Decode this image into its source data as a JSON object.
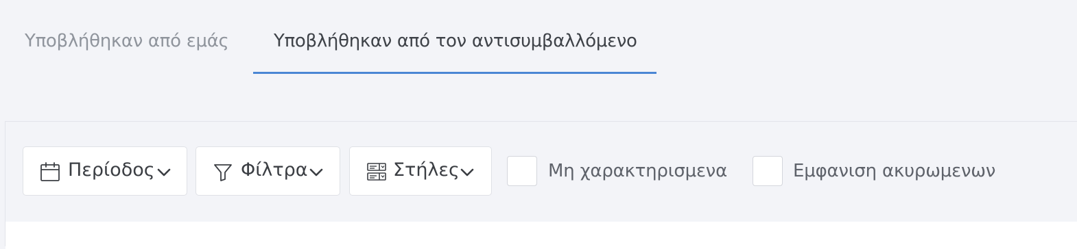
{
  "tabs": [
    {
      "label": "Υποβλήθηκαν από εμάς",
      "active": false
    },
    {
      "label": "Υποβλήθηκαν από τον αντισυμβαλλόμενο",
      "active": true
    }
  ],
  "toolbar": {
    "period_label": "Περίοδος",
    "filters_label": "Φίλτρα",
    "columns_label": "Στήλες",
    "uncharacterized_label": "Μη χαρακτηρισμενα",
    "uncharacterized_checked": false,
    "show_cancelled_label": "Εμφανιση ακυρωμενων",
    "show_cancelled_checked": false
  },
  "colors": {
    "accent": "#4a86d4",
    "background": "#f3f4f8",
    "tab_inactive_text": "#8f949c",
    "tab_active_text": "#3e4248"
  },
  "icons": {
    "period": "calendar-icon",
    "filters": "funnel-icon",
    "columns": "columns-icon",
    "dropdown": "chevron-down-icon"
  }
}
